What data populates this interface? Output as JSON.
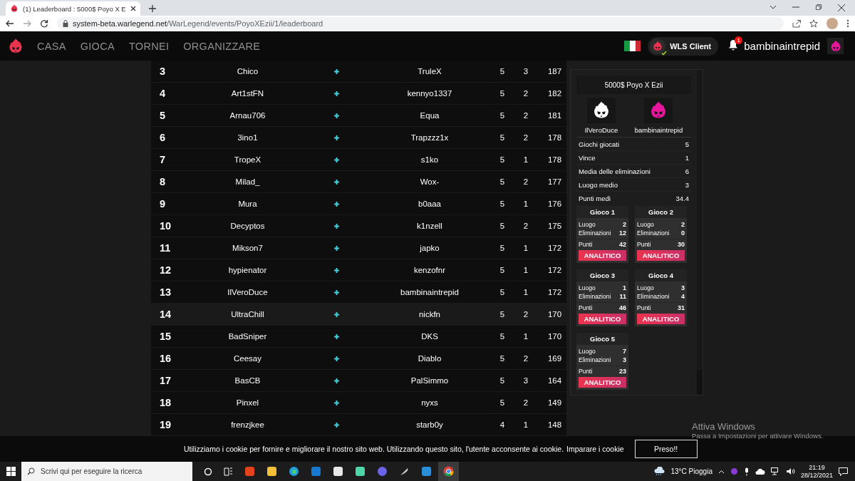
{
  "browser": {
    "tab_title": "(1) Leaderboard : 5000$ Poyo X E",
    "url_host": "system-beta.warlegend.net",
    "url_path": "/WarLegend/events/PoyoXEzii/1/leaderboard"
  },
  "nav": {
    "links": [
      "CASA",
      "GIOCA",
      "TORNEI",
      "ORGANIZZARE"
    ],
    "client_label": "WLS Client",
    "notification_count": "1",
    "username": "bambinaintrepid"
  },
  "leaderboard": {
    "rows": [
      {
        "rank": "3",
        "player_1": "Chico",
        "player_2": "TruleX",
        "games": "5",
        "wins": "3",
        "points": "187",
        "hovered": false
      },
      {
        "rank": "4",
        "player_1": "Art1stFN",
        "player_2": "kennyo1337",
        "games": "5",
        "wins": "2",
        "points": "182",
        "hovered": false
      },
      {
        "rank": "5",
        "player_1": "Arnau706",
        "player_2": "Equa",
        "games": "5",
        "wins": "2",
        "points": "181",
        "hovered": false
      },
      {
        "rank": "6",
        "player_1": "3ino1",
        "player_2": "Trapzzz1x",
        "games": "5",
        "wins": "2",
        "points": "178",
        "hovered": false
      },
      {
        "rank": "7",
        "player_1": "TropeX",
        "player_2": "s1ko",
        "games": "5",
        "wins": "1",
        "points": "178",
        "hovered": false
      },
      {
        "rank": "8",
        "player_1": "Milad_",
        "player_2": "Wox-",
        "games": "5",
        "wins": "2",
        "points": "177",
        "hovered": false
      },
      {
        "rank": "9",
        "player_1": "Mura",
        "player_2": "b0aaa",
        "games": "5",
        "wins": "1",
        "points": "176",
        "hovered": false
      },
      {
        "rank": "10",
        "player_1": "Decyptos",
        "player_2": "k1nzell",
        "games": "5",
        "wins": "2",
        "points": "175",
        "hovered": false
      },
      {
        "rank": "11",
        "player_1": "Mikson7",
        "player_2": "japko",
        "games": "5",
        "wins": "1",
        "points": "172",
        "hovered": false
      },
      {
        "rank": "12",
        "player_1": "hypienator",
        "player_2": "kenzofnr",
        "games": "5",
        "wins": "1",
        "points": "172",
        "hovered": false
      },
      {
        "rank": "13",
        "player_1": "IlVeroDuce",
        "player_2": "bambinaintrepid",
        "games": "5",
        "wins": "1",
        "points": "172",
        "hovered": false
      },
      {
        "rank": "14",
        "player_1": "UltraChill",
        "player_2": "nickfn",
        "games": "5",
        "wins": "2",
        "points": "170",
        "hovered": true
      },
      {
        "rank": "15",
        "player_1": "BadSniper",
        "player_2": "DKS",
        "games": "5",
        "wins": "1",
        "points": "170",
        "hovered": false
      },
      {
        "rank": "16",
        "player_1": "Ceesay",
        "player_2": "Diablo",
        "games": "5",
        "wins": "2",
        "points": "169",
        "hovered": false
      },
      {
        "rank": "17",
        "player_1": "BasCB",
        "player_2": "PalSimmo",
        "games": "5",
        "wins": "3",
        "points": "164",
        "hovered": false
      },
      {
        "rank": "18",
        "player_1": "Pinxel",
        "player_2": "nyxs",
        "games": "5",
        "wins": "2",
        "points": "149",
        "hovered": false
      },
      {
        "rank": "19",
        "player_1": "frenzjkee",
        "player_2": "starb0y",
        "games": "4",
        "wins": "1",
        "points": "148",
        "hovered": false
      }
    ]
  },
  "player_panel": {
    "event_title": "5000$ Poyo X Ezii",
    "players": [
      {
        "name": "IlVeroDuce",
        "color": "#ffffff"
      },
      {
        "name": "bambinaintrepid",
        "color": "#e6179b"
      }
    ],
    "stats": [
      {
        "label": "Giochi giocati",
        "value": "5"
      },
      {
        "label": "Vince",
        "value": "1"
      },
      {
        "label": "Media delle eliminazioni",
        "value": "6"
      },
      {
        "label": "Luogo medio",
        "value": "3"
      },
      {
        "label": "Punti medi",
        "value": "34.4"
      }
    ],
    "games": [
      {
        "title": "Gioco 1",
        "place_label": "Luogo",
        "place": "2",
        "kills_label": "Eliminazioni",
        "kills": "12",
        "points_label": "Punti",
        "points": "42",
        "button": "ANALITICO"
      },
      {
        "title": "Gioco 2",
        "place_label": "Luogo",
        "place": "2",
        "kills_label": "Eliminazioni",
        "kills": "0",
        "points_label": "Punti",
        "points": "30",
        "button": "ANALITICO"
      },
      {
        "title": "Gioco 3",
        "place_label": "Luogo",
        "place": "1",
        "kills_label": "Eliminazioni",
        "kills": "11",
        "points_label": "Punti",
        "points": "46",
        "button": "ANALITICO"
      },
      {
        "title": "Gioco 4",
        "place_label": "Luogo",
        "place": "3",
        "kills_label": "Eliminazioni",
        "kills": "4",
        "points_label": "Punti",
        "points": "31",
        "button": "ANALITICO"
      },
      {
        "title": "Gioco 5",
        "place_label": "Luogo",
        "place": "7",
        "kills_label": "Eliminazioni",
        "kills": "3",
        "points_label": "Punti",
        "points": "23",
        "button": "ANALITICO"
      }
    ]
  },
  "cookie_bar": {
    "text": "Utilizziamo i cookie per fornire e migliorare il nostro sito web. Utilizzando questo sito, l'utente acconsente ai cookie.",
    "link": "Imparare i cookie",
    "button": "Preso!!"
  },
  "activation_notice": {
    "title": "Attiva Windows",
    "subtitle": "Passa a Impostazioni per attivare Windows."
  },
  "taskbar": {
    "search_placeholder": "Scrivi qui per eseguire la ricerca",
    "weather": "13°C Pioggia",
    "time": "21:19",
    "date": "28/12/2021"
  }
}
